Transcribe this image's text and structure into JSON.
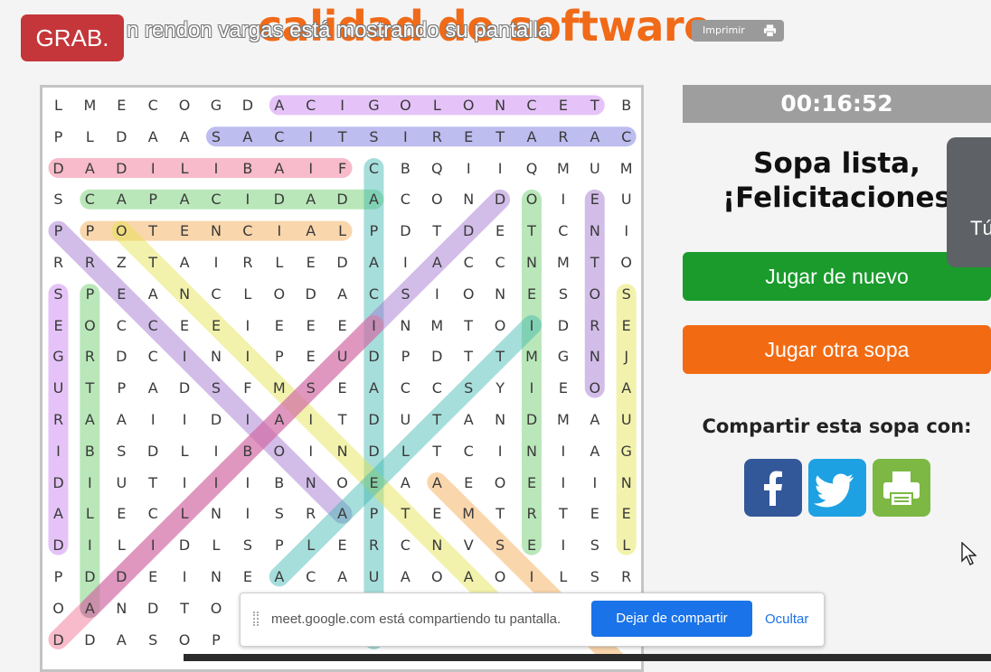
{
  "header": {
    "title_fragment": "calidad de software",
    "print_label": "Imprimir"
  },
  "recording": {
    "badge": "GRAB.",
    "share_caption": "n rendon vargas está mostrando su pantalla"
  },
  "puzzle": {
    "rows": [
      "LMECOGDACIGOLONCETB",
      "PLDAASACITSIRETARAC",
      "DADILIBAIFCBQIIQMUM",
      "SCAPACIDADACONDOIEU",
      "PPOTENCIALPDTDETCNI",
      "RRZTAIRLEDAIACCNMTO",
      "SPEANCLODACSIONESOS",
      "EOCCEEIEEEINMTOIDRE",
      "GRDCINIPEUDPDTTMGNJ",
      "UTPADSFMSEACCSYIEOA",
      "RAAIIDIAITDUTANDMAU",
      "IBSDLIBOINDLTCINIAG",
      "DIUTIIIBNOEAAEOEIIN",
      "ALECLNISRAPTEMTRTEE",
      "DILIDLSPLERCNVSEISL",
      "PDDEINEACAUAOAOILSR",
      "OANDTO",
      "DDASOP"
    ],
    "highlight_colors": [
      "#c77cf0",
      "#6f6fe0",
      "#f06a8e",
      "#66cc66",
      "#f5a54a",
      "#3cb8b0",
      "#e4e44a",
      "#9d6fd0"
    ]
  },
  "timer": {
    "value": "00:16:52"
  },
  "completion": {
    "line1": "Sopa lista,",
    "line2": "¡Felicitaciones"
  },
  "buttons": {
    "play_again": "Jugar de nuevo",
    "play_other": "Jugar otra sopa"
  },
  "share": {
    "label": "Compartir esta sopa con:",
    "icons": [
      "facebook-icon",
      "twitter-icon",
      "printer-icon"
    ]
  },
  "side_panel": {
    "text": "Tú"
  },
  "notification": {
    "message": "meet.google.com está compartiendo tu pantalla.",
    "stop_button": "Dejar de compartir",
    "hide_link": "Ocultar"
  }
}
